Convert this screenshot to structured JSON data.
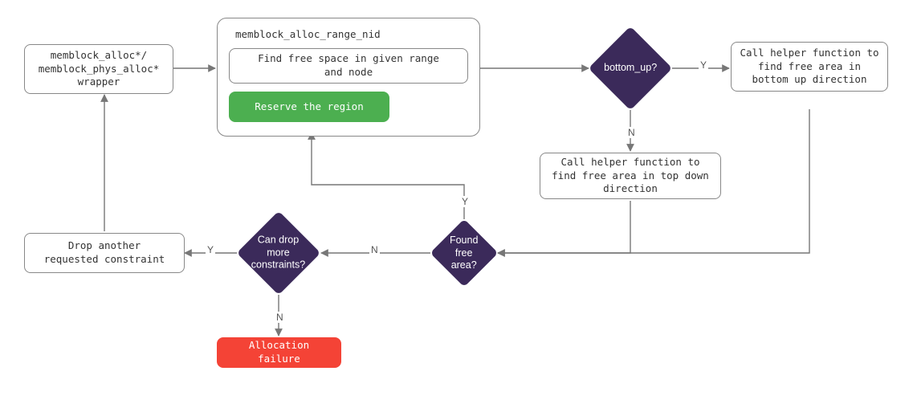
{
  "diagram": {
    "wrapper": "memblock_alloc*/\nmemblock_phys_alloc*\nwrapper",
    "container_title": "memblock_alloc_range_nid",
    "find_free": "Find free space in given range\nand node",
    "reserve": "Reserve the region",
    "bottom_up": "bottom_up?",
    "helper_bu": "Call helper function to\nfind free area in\nbottom up direction",
    "helper_td": "Call helper function to\nfind free area in top down\ndirection",
    "found": "Found\nfree\narea?",
    "can_drop": "Can drop\nmore\nconstraints?",
    "drop_constraint": "Drop another\nrequested constraint",
    "alloc_fail": "Allocation failure",
    "label_Y": "Y",
    "label_N": "N"
  }
}
